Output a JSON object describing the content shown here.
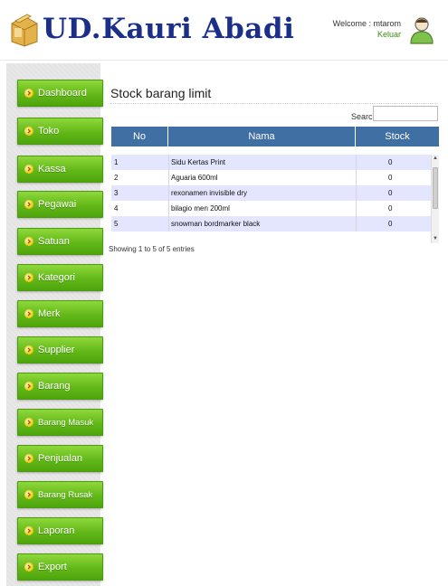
{
  "header": {
    "brand": "UD.Kauri Abadi",
    "welcome": "Welcome : mtarom",
    "logout": "Keluar"
  },
  "sidebar": {
    "items": [
      {
        "label": "Dashboard"
      },
      {
        "label": "Toko"
      },
      {
        "label": "Kassa"
      },
      {
        "label": "Pegawai"
      },
      {
        "label": "Satuan"
      },
      {
        "label": "Kategori"
      },
      {
        "label": "Merk"
      },
      {
        "label": "Supplier"
      },
      {
        "label": "Barang"
      },
      {
        "label": "Barang Masuk"
      },
      {
        "label": "Penjualan"
      },
      {
        "label": "Barang Rusak"
      },
      {
        "label": "Laporan"
      },
      {
        "label": "Export"
      }
    ]
  },
  "main": {
    "title": "Stock barang limit",
    "search_label": "Search:",
    "search_value": "",
    "table": {
      "headers": [
        "No",
        "Nama",
        "Stock"
      ],
      "rows": [
        {
          "no": "1",
          "nama": "Sidu Kertas Print",
          "stock": "0"
        },
        {
          "no": "2",
          "nama": "Aguaria 600ml",
          "stock": "0"
        },
        {
          "no": "3",
          "nama": "rexonamen invisible dry",
          "stock": "0"
        },
        {
          "no": "4",
          "nama": "bilagio men 200ml",
          "stock": "0"
        },
        {
          "no": "5",
          "nama": "snowman bordmarker black",
          "stock": "0"
        }
      ]
    },
    "info": "Showing 1 to 5 of 5 entries"
  },
  "colors": {
    "nav_green": "#62b818",
    "table_header": "#3f6fa3",
    "row_highlight": "#e4e6ff",
    "brand_blue": "#1b2f8a"
  },
  "icons": {
    "logo": "folder-box-icon",
    "user": "user-avatar-icon",
    "nav_bullet": "chevron-right-icon"
  }
}
